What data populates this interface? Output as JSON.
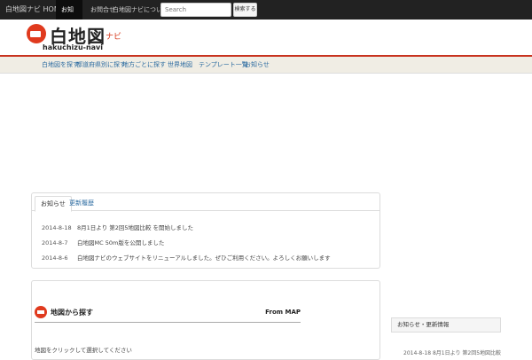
{
  "topnav": {
    "home": "白地図ナビ HOME",
    "active": "お知らせ",
    "nav2": "お問合せ",
    "nav3": "白地図ナビについて ▾",
    "search_placeholder": "Search",
    "search_button": "検索する"
  },
  "logo": {
    "title": "白地図",
    "navi": "ナビ",
    "sub": "hakuchizu-navi"
  },
  "menu": [
    "白地図を探す",
    "都道府県別に探す",
    "地方ごとに探す",
    "世界地図",
    "テンプレート一覧",
    "お知らせ"
  ],
  "tabs": [
    "お知らせ",
    "更新履歴"
  ],
  "news": [
    {
      "date": "2014-8-18",
      "text": "8月1日より 第2回5地図比較 を開始しました"
    },
    {
      "date": "2014-8-7",
      "text": "白地図MC 50m版を公開しました"
    },
    {
      "date": "2014-8-6",
      "text": "白地図ナビのウェブサイトをリニューアルしました。ぜひご利用ください。よろしくお願いします"
    }
  ],
  "map_section": {
    "title": "地図から探す",
    "from": "From MAP",
    "desc": "地図をクリックして選択してください"
  },
  "sidebar": {
    "title": "お知らせ・更新情報",
    "news": "2014-8-18  8月1日より 第2回5地図比較"
  },
  "colors": {
    "accent": "#e03a1e",
    "link": "#2a6aa0",
    "topbar": "#222222"
  }
}
